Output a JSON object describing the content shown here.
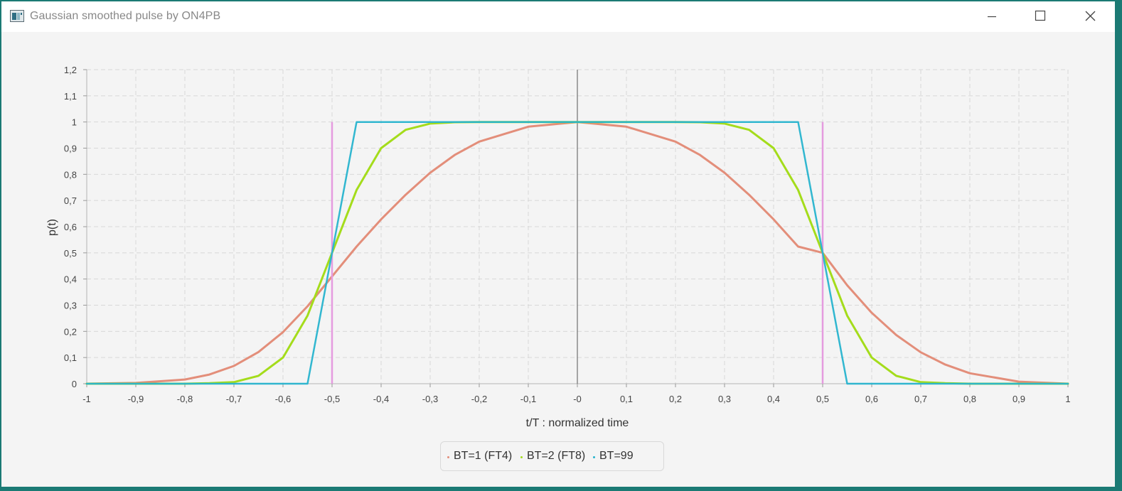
{
  "window": {
    "title": "Gaussian smoothed pulse by ON4PB",
    "app_icon": "app-icon",
    "controls": [
      "minimize-icon",
      "maximize-icon",
      "close-icon"
    ]
  },
  "colors": {
    "bt1": "#e38e7a",
    "bt2": "#a4dc1b",
    "bt99": "#27b3cd",
    "bt99_steep": "#e59bdf",
    "zero_line": "#555555",
    "grid": "#d8d8d8"
  },
  "chart_data": {
    "type": "line",
    "xlabel": "t/T : normalized time",
    "ylabel": "p(t)",
    "xlim": [
      -1,
      1
    ],
    "ylim": [
      0,
      1.2
    ],
    "x_ticks": [
      -1,
      -0.9,
      -0.8,
      -0.7,
      -0.6,
      -0.5,
      -0.4,
      -0.3,
      -0.2,
      -0.1,
      0,
      0.1,
      0.2,
      0.3,
      0.4,
      0.5,
      0.6,
      0.7,
      0.8,
      0.9,
      1
    ],
    "x_tick_labels": [
      "-1",
      "-0,9",
      "-0,8",
      "-0,7",
      "-0,6",
      "-0,5",
      "-0,4",
      "-0,3",
      "-0,2",
      "-0,1",
      "-0",
      "0,1",
      "0,2",
      "0,3",
      "0,4",
      "0,5",
      "0,6",
      "0,7",
      "0,8",
      "0,9",
      "1"
    ],
    "y_ticks": [
      0,
      0.1,
      0.2,
      0.3,
      0.4,
      0.5,
      0.6,
      0.7,
      0.8,
      0.9,
      1,
      1.1,
      1.2
    ],
    "y_tick_labels": [
      "0",
      "0,1",
      "0,2",
      "0,3",
      "0,4",
      "0,5",
      "0,6",
      "0,7",
      "0,8",
      "0,9",
      "1",
      "1,1",
      "1,2"
    ],
    "grid": true,
    "grid_style": "dashed",
    "legend_position": "bottom-center",
    "x": [
      -1,
      -0.9,
      -0.8,
      -0.75,
      -0.7,
      -0.65,
      -0.6,
      -0.55,
      -0.5,
      -0.45,
      -0.4,
      -0.35,
      -0.3,
      -0.25,
      -0.2,
      -0.1,
      0,
      0.1,
      0.2,
      0.25,
      0.3,
      0.35,
      0.4,
      0.45,
      0.5,
      0.55,
      0.6,
      0.65,
      0.7,
      0.75,
      0.8,
      0.9,
      1
    ],
    "series": [
      {
        "name": "BT=1 (FT4)",
        "values": [
          0.0,
          0.003,
          0.016,
          0.035,
          0.068,
          0.121,
          0.197,
          0.296,
          0.41,
          0.524,
          0.628,
          0.722,
          0.806,
          0.874,
          0.925,
          0.982,
          1.0,
          0.982,
          0.925,
          0.874,
          0.806,
          0.722,
          0.628,
          0.524,
          0.5,
          0.376,
          0.271,
          0.186,
          0.12,
          0.073,
          0.04,
          0.008,
          0.0
        ]
      },
      {
        "name": "BT=2 (FT8)",
        "values": [
          0.0,
          0.0,
          0.0,
          0.002,
          0.006,
          0.03,
          0.1,
          0.26,
          0.5,
          0.74,
          0.9,
          0.97,
          0.994,
          0.999,
          1.0,
          1.0,
          1.0,
          1.0,
          1.0,
          0.999,
          0.994,
          0.97,
          0.9,
          0.74,
          0.5,
          0.26,
          0.1,
          0.03,
          0.006,
          0.002,
          0.0,
          0.0,
          0.0
        ]
      },
      {
        "name": "BT=99",
        "values": [
          0.0,
          0.0,
          0.0,
          0.0,
          0.0,
          0.0,
          0.0,
          0.0,
          0.5,
          1.0,
          1.0,
          1.0,
          1.0,
          1.0,
          1.0,
          1.0,
          1.0,
          1.0,
          1.0,
          1.0,
          1.0,
          1.0,
          1.0,
          1.0,
          0.5,
          0.0,
          0.0,
          0.0,
          0.0,
          0.0,
          0.0,
          0.0,
          0.0
        ]
      }
    ]
  }
}
